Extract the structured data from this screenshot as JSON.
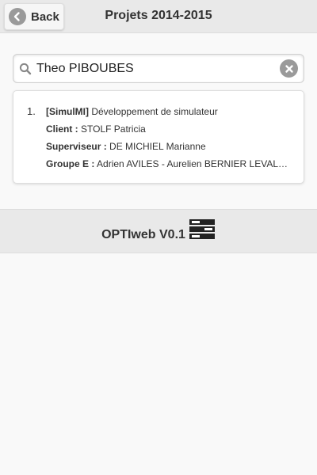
{
  "header": {
    "back_label": "Back",
    "title": "Projets 2014-2015"
  },
  "search": {
    "value": "Theo PIBOUBES",
    "placeholder": ""
  },
  "results": [
    {
      "number": "1.",
      "project_tag": "[SimulMI]",
      "project_name": " Développement de simulateur",
      "client_label": "Client :",
      "client_value": " STOLF Patricia",
      "supervisor_label": "Superviseur :",
      "supervisor_value": " DE MICHIEL Marianne",
      "group_label": "Groupe E :",
      "group_value": " Adrien AVILES - Aurelien BERNIER LEVALO..."
    }
  ],
  "footer": {
    "title": "OPTIweb V0.1",
    "logo_icon": "server-stack-icon"
  },
  "colors": {
    "header_bg": "#e9e9e9",
    "page_bg": "#f9f9f9",
    "icon_gray": "#9a9a9a",
    "logo_dark": "#222222"
  }
}
